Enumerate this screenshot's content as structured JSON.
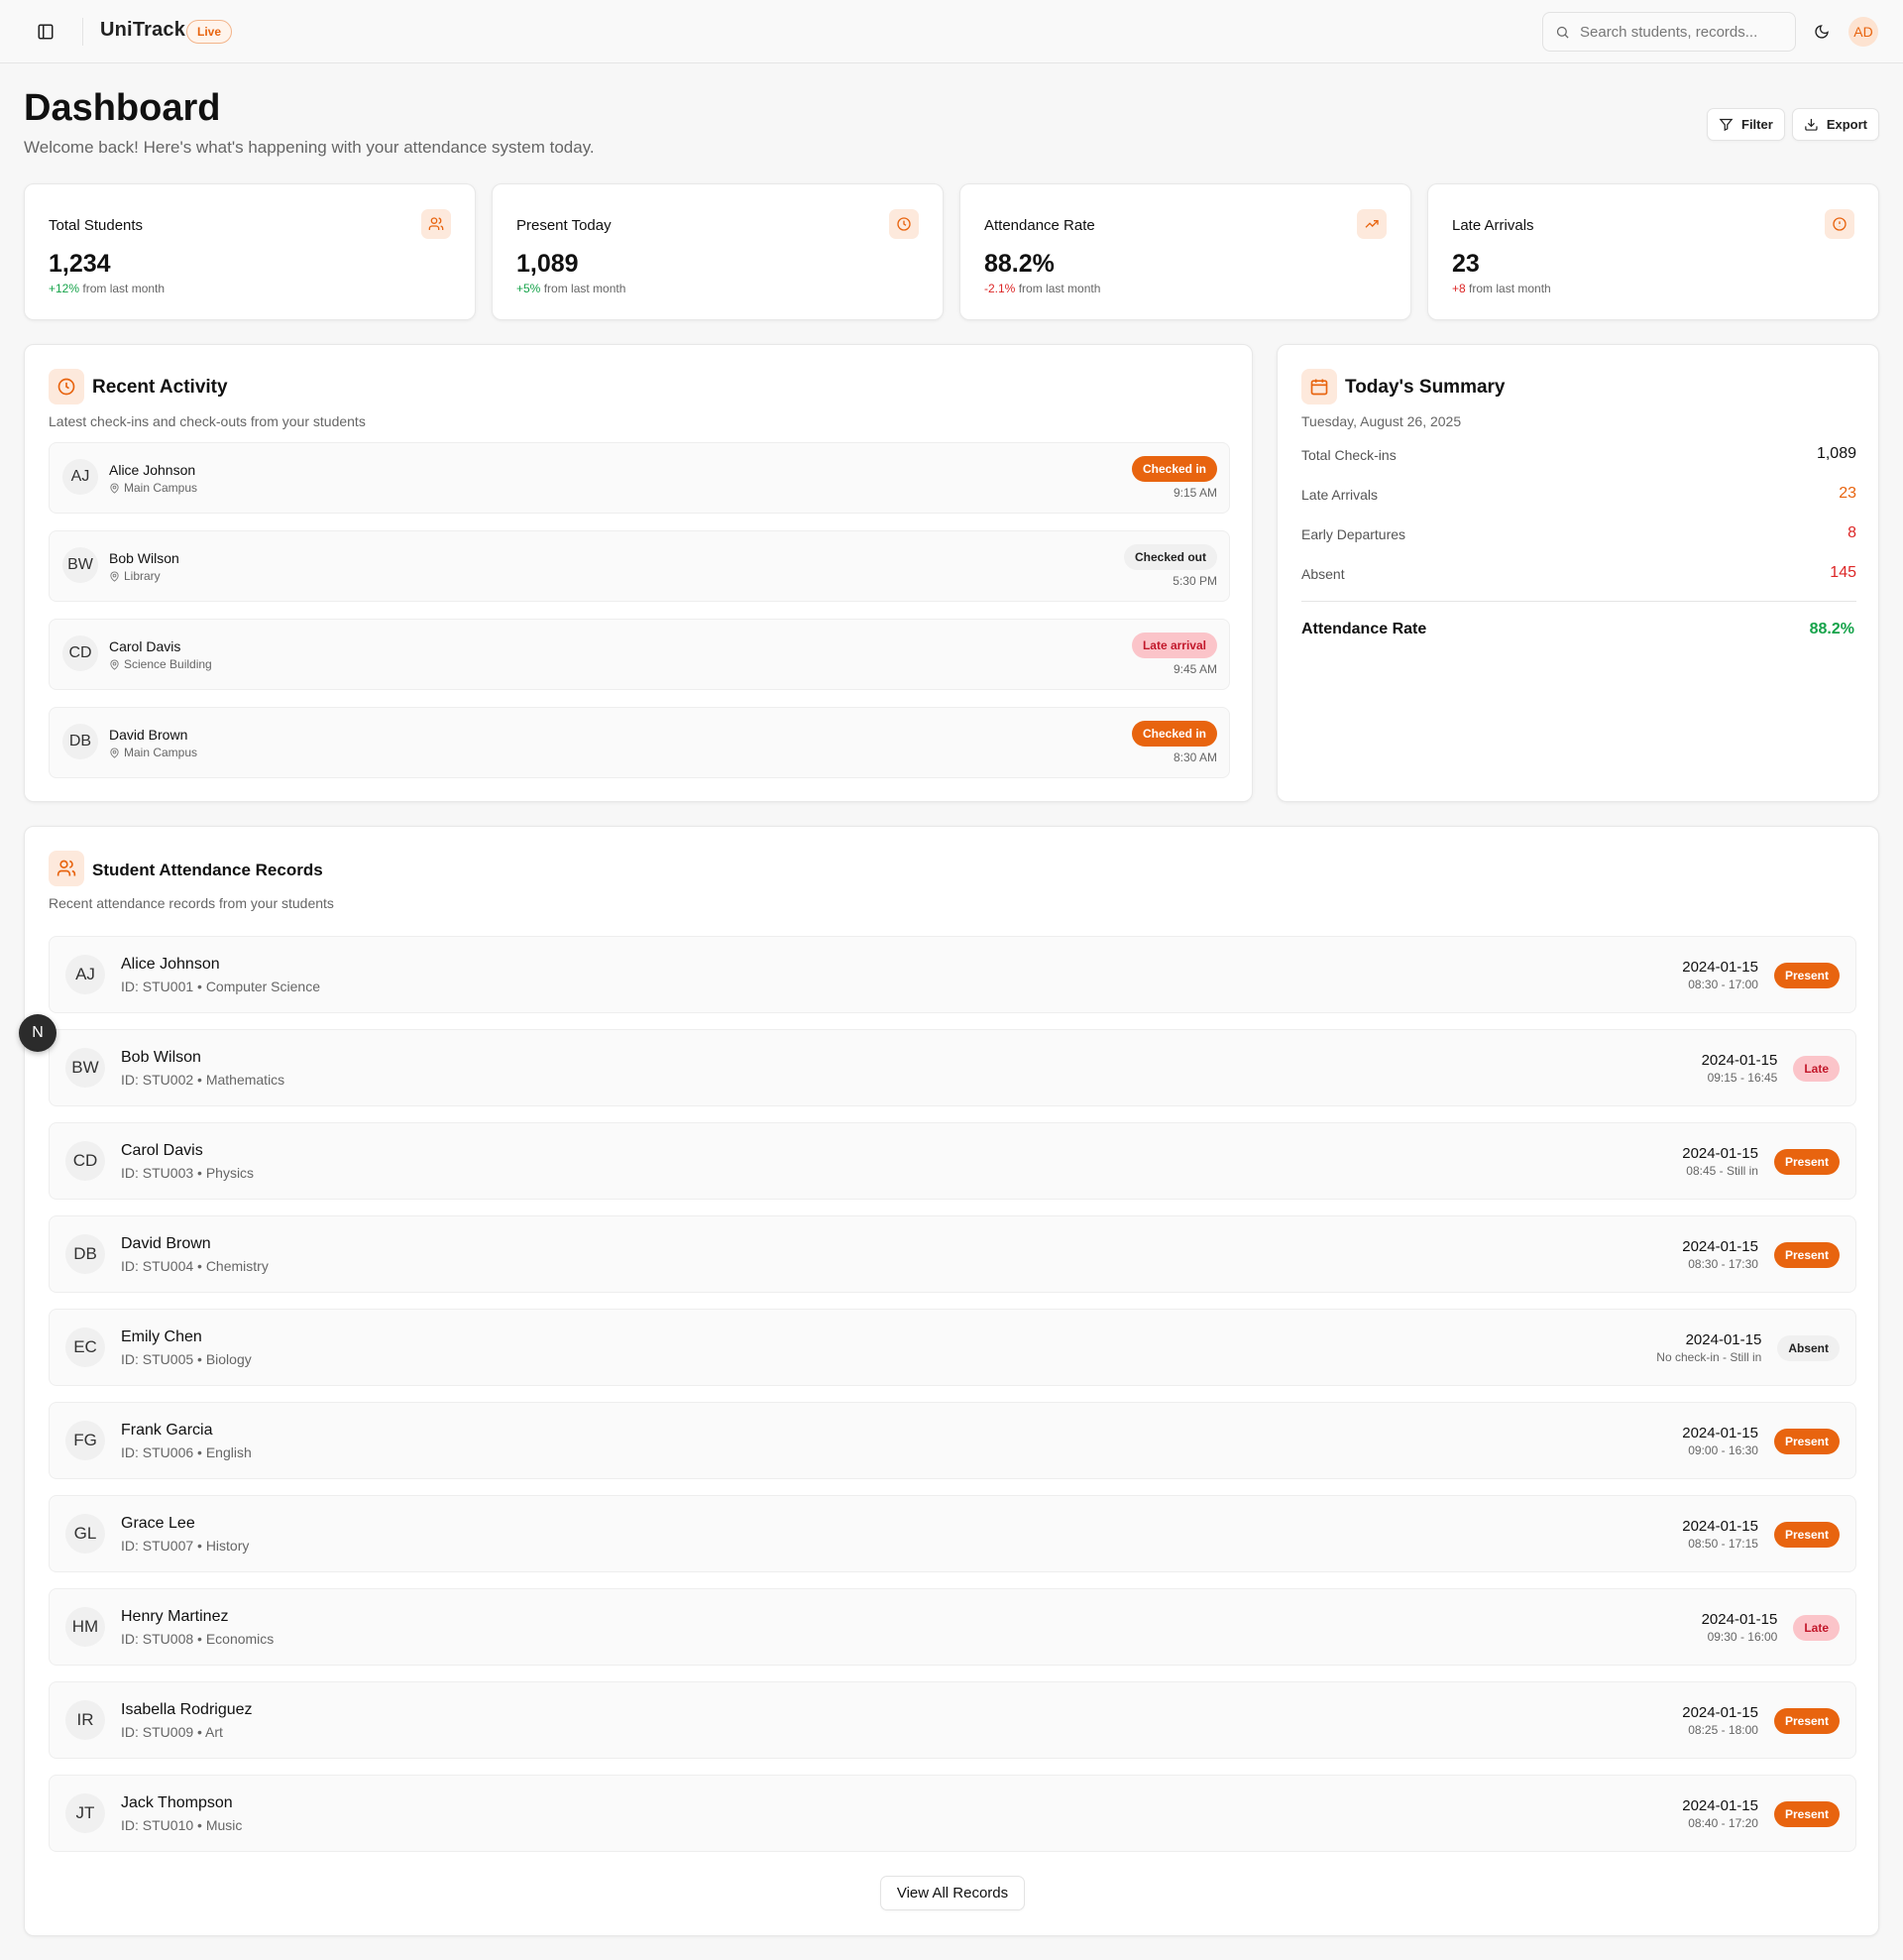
{
  "header": {
    "brand": "UniTrack",
    "live_badge": "Live",
    "search_placeholder": "Search students, records...",
    "user_initials": "AD"
  },
  "page": {
    "title": "Dashboard",
    "subtitle": "Welcome back! Here's what's happening with your attendance system today.",
    "filter_label": "Filter",
    "export_label": "Export"
  },
  "stats": [
    {
      "label": "Total Students",
      "value": "1,234",
      "change": "+12%",
      "change_suffix": "from last month",
      "trend": "positive",
      "icon": "users-icon"
    },
    {
      "label": "Present Today",
      "value": "1,089",
      "change": "+5%",
      "change_suffix": "from last month",
      "trend": "positive",
      "icon": "clock-icon"
    },
    {
      "label": "Attendance Rate",
      "value": "88.2%",
      "change": "-2.1%",
      "change_suffix": "from last month",
      "trend": "negative",
      "icon": "trending-up-icon"
    },
    {
      "label": "Late Arrivals",
      "value": "23",
      "change": "+8",
      "change_suffix": "from last month",
      "trend": "negative",
      "icon": "alert-circle-icon"
    }
  ],
  "activity": {
    "title": "Recent Activity",
    "subtitle": "Latest check-ins and check-outs from your students",
    "items": [
      {
        "initials": "AJ",
        "name": "Alice Johnson",
        "location": "Main Campus",
        "status": "Checked in",
        "time": "9:15 AM"
      },
      {
        "initials": "BW",
        "name": "Bob Wilson",
        "location": "Library",
        "status": "Checked out",
        "time": "5:30 PM"
      },
      {
        "initials": "CD",
        "name": "Carol Davis",
        "location": "Science Building",
        "status": "Late arrival",
        "time": "9:45 AM"
      },
      {
        "initials": "DB",
        "name": "David Brown",
        "location": "Main Campus",
        "status": "Checked in",
        "time": "8:30 AM"
      }
    ]
  },
  "summary": {
    "title": "Today's Summary",
    "date": "Tuesday, August 26, 2025",
    "rows": [
      {
        "label": "Total Check-ins",
        "value": "1,089",
        "color": "#111111"
      },
      {
        "label": "Late Arrivals",
        "value": "23",
        "color": "#e8640f"
      },
      {
        "label": "Early Departures",
        "value": "8",
        "color": "#dc2626"
      },
      {
        "label": "Absent",
        "value": "145",
        "color": "#dc2626"
      }
    ],
    "rate_label": "Attendance Rate",
    "rate_value": "88.2%"
  },
  "records": {
    "title": "Student Attendance Records",
    "subtitle": "Recent attendance records from your students",
    "items": [
      {
        "initials": "AJ",
        "name": "Alice Johnson",
        "meta": "ID: STU001 • Computer Science",
        "date": "2024-01-15",
        "time": "08:30 - 17:00",
        "status": "Present"
      },
      {
        "initials": "BW",
        "name": "Bob Wilson",
        "meta": "ID: STU002 • Mathematics",
        "date": "2024-01-15",
        "time": "09:15 - 16:45",
        "status": "Late"
      },
      {
        "initials": "CD",
        "name": "Carol Davis",
        "meta": "ID: STU003 • Physics",
        "date": "2024-01-15",
        "time": "08:45 - Still in",
        "status": "Present"
      },
      {
        "initials": "DB",
        "name": "David Brown",
        "meta": "ID: STU004 • Chemistry",
        "date": "2024-01-15",
        "time": "08:30 - 17:30",
        "status": "Present"
      },
      {
        "initials": "EC",
        "name": "Emily Chen",
        "meta": "ID: STU005 • Biology",
        "date": "2024-01-15",
        "time": "No check-in - Still in",
        "status": "Absent"
      },
      {
        "initials": "FG",
        "name": "Frank Garcia",
        "meta": "ID: STU006 • English",
        "date": "2024-01-15",
        "time": "09:00 - 16:30",
        "status": "Present"
      },
      {
        "initials": "GL",
        "name": "Grace Lee",
        "meta": "ID: STU007 • History",
        "date": "2024-01-15",
        "time": "08:50 - 17:15",
        "status": "Present"
      },
      {
        "initials": "HM",
        "name": "Henry Martinez",
        "meta": "ID: STU008 • Economics",
        "date": "2024-01-15",
        "time": "09:30 - 16:00",
        "status": "Late"
      },
      {
        "initials": "IR",
        "name": "Isabella Rodriguez",
        "meta": "ID: STU009 • Art",
        "date": "2024-01-15",
        "time": "08:25 - 18:00",
        "status": "Present"
      },
      {
        "initials": "JT",
        "name": "Jack Thompson",
        "meta": "ID: STU010 • Music",
        "date": "2024-01-15",
        "time": "08:40 - 17:20",
        "status": "Present"
      }
    ],
    "view_all_label": "View All Records"
  },
  "fab_label": "N",
  "colors": {
    "accent": "#e8640f",
    "positive": "#16a34a",
    "negative": "#dc2626",
    "late_bg": "#fbc4c9"
  }
}
